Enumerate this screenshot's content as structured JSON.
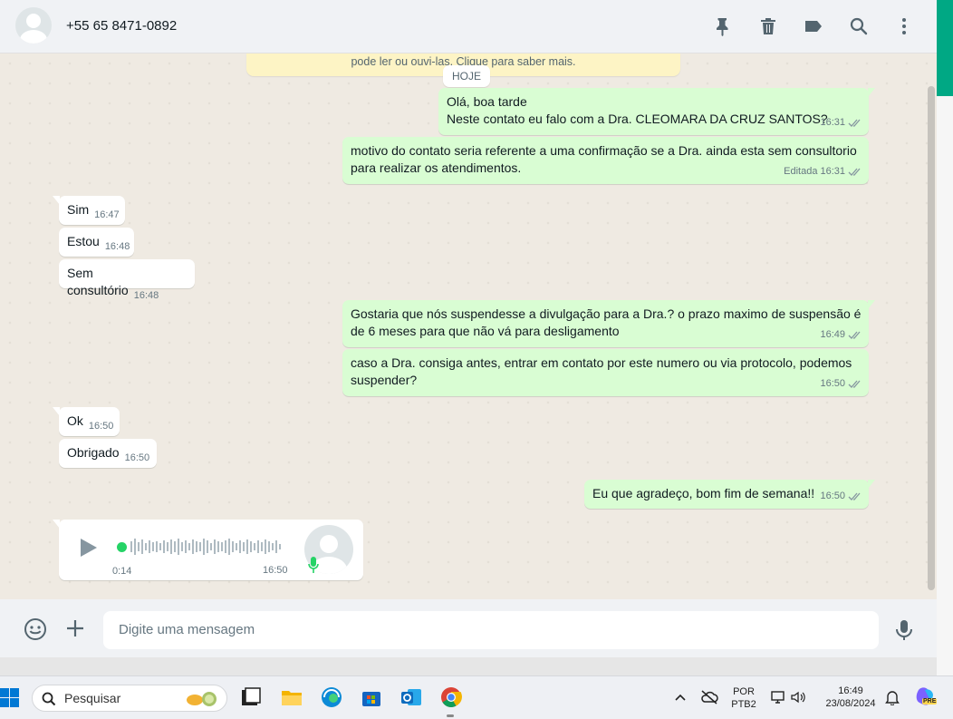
{
  "header": {
    "contact": "+55 65 8471-0892"
  },
  "notice": {
    "text": "pode ler ou ouvi-las. Clique para saber mais."
  },
  "day_label": "HOJE",
  "messages": {
    "m1": {
      "line1": "Olá, boa tarde",
      "line2": "Neste contato eu falo com a Dra. CLEOMARA DA CRUZ SANTOS?",
      "time": "16:31"
    },
    "m2": {
      "text": "motivo do contato seria referente a uma confirmação se a Dra. ainda esta sem consultorio para realizar os atendimentos.",
      "edited": "Editada",
      "time": "16:31"
    },
    "m3": {
      "text": "Sim",
      "time": "16:47"
    },
    "m4": {
      "text": "Estou",
      "time": "16:48"
    },
    "m5": {
      "text": "Sem consultório",
      "time": "16:48"
    },
    "m6": {
      "text": "Gostaria que nós suspendesse a divulgação para a Dra.? o prazo maximo de suspensão é de 6 meses para que não vá para desligamento",
      "time": "16:49"
    },
    "m7": {
      "text": "caso a Dra. consiga antes, entrar em contato por este numero ou via protocolo, podemos suspender?",
      "time": "16:50"
    },
    "m8": {
      "text": "Ok",
      "time": "16:50"
    },
    "m9": {
      "text": "Obrigado",
      "time": "16:50"
    },
    "m10": {
      "text": "Eu que agradeço, bom fim de semana!!",
      "time": "16:50"
    }
  },
  "voice": {
    "duration": "0:14",
    "time": "16:50"
  },
  "composer": {
    "placeholder": "Digite uma mensagem"
  },
  "taskbar": {
    "search": "Pesquisar",
    "lang1": "POR",
    "lang2": "PTB2",
    "time": "16:49",
    "date": "23/08/2024",
    "copilot_badge": "PRE"
  },
  "colors": {
    "outgoing": "#d9fdd3",
    "incoming": "#ffffff",
    "accent": "#00a884"
  },
  "icons": [
    "pin-icon",
    "trash-icon",
    "label-icon",
    "search-icon",
    "menu-icon",
    "emoji-icon",
    "plus-icon",
    "mic-icon",
    "play-icon"
  ]
}
